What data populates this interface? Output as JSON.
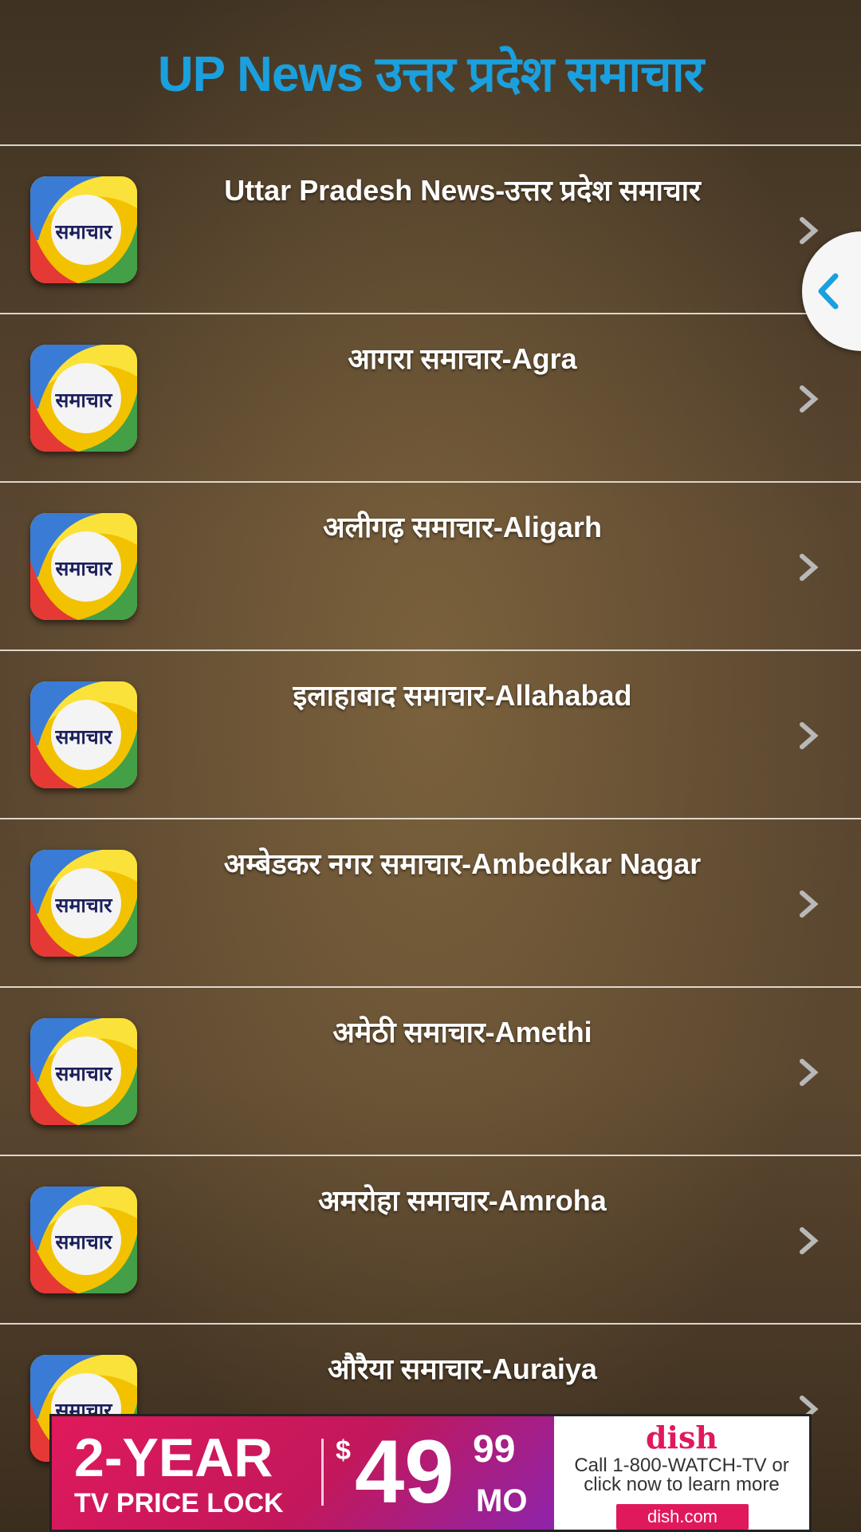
{
  "header": {
    "title": "UP News उत्तर प्रदेश समाचार"
  },
  "icon_text": "समाचार",
  "news_list": [
    {
      "label": "Uttar Pradesh News-उत्तर प्रदेश समाचार"
    },
    {
      "label": "आगरा समाचार-Agra"
    },
    {
      "label": "अलीगढ़ समाचार-Aligarh"
    },
    {
      "label": "इलाहाबाद समाचार-Allahabad"
    },
    {
      "label": "अम्बेडकर नगर समाचार-Ambedkar Nagar"
    },
    {
      "label": "अमेठी समाचार-Amethi"
    },
    {
      "label": "अमरोहा समाचार-Amroha"
    },
    {
      "label": "औरैया समाचार-Auraiya"
    }
  ],
  "icons": {
    "row_chevron": "chevron-right-icon",
    "side_tab": "chevron-left-icon"
  },
  "colors": {
    "title": "#1aa0de",
    "ad_pink": "#e0195c"
  },
  "ad": {
    "headline": "2-YEAR",
    "subline": "TV PRICE LOCK",
    "currency": "$",
    "price": "49",
    "cents": "99",
    "period": "MO",
    "brand": "dish",
    "copy": "Call 1-800-WATCH-TV or click now to learn more",
    "cta": "dish.com"
  }
}
